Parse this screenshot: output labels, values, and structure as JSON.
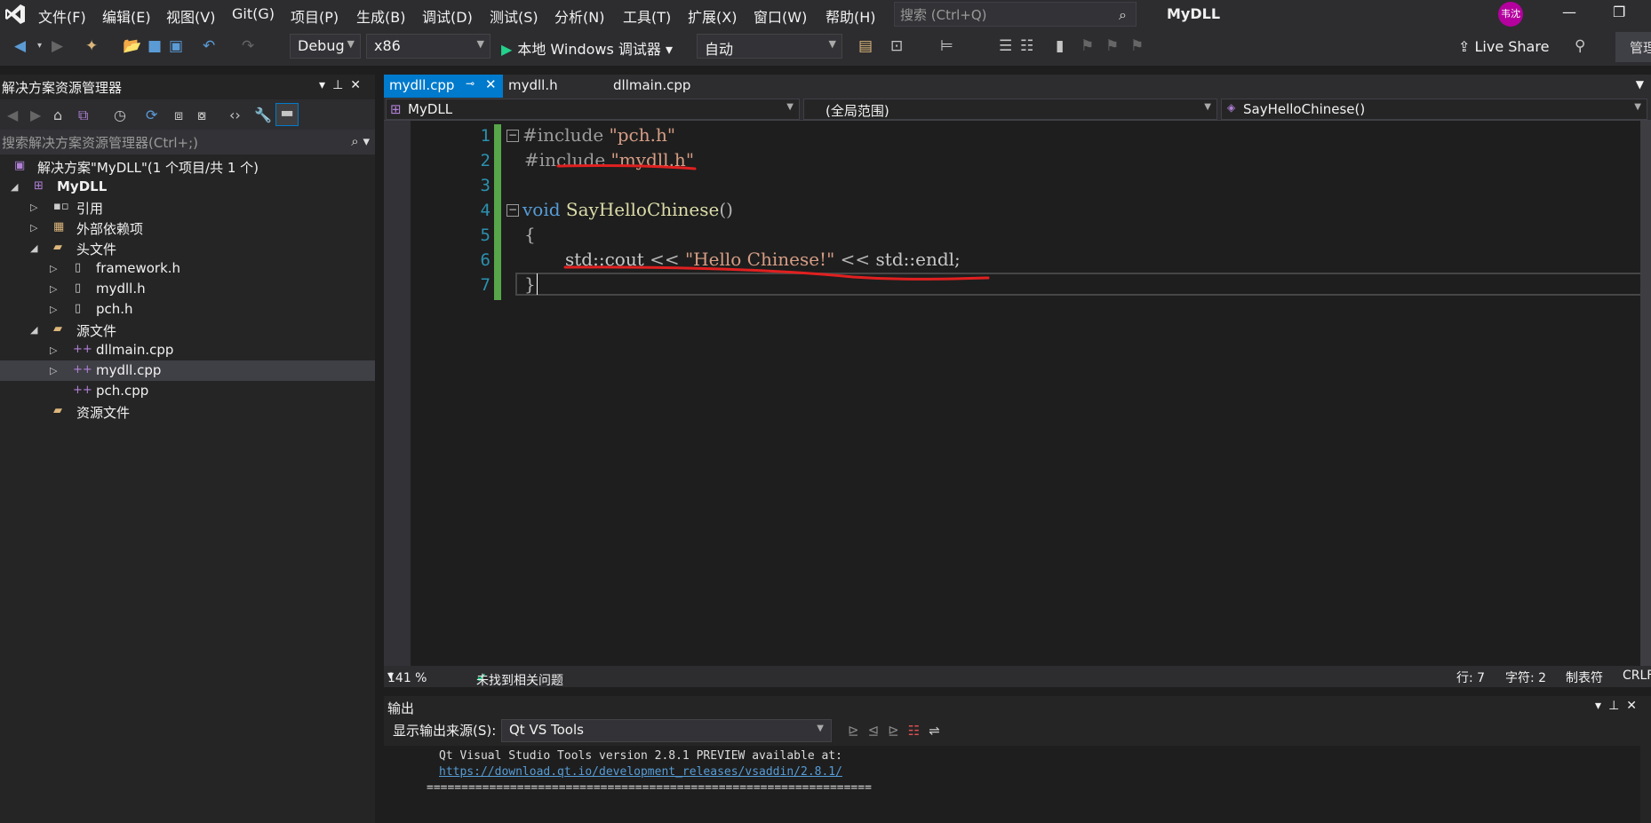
{
  "menubar": {
    "items": [
      "文件(F)",
      "编辑(E)",
      "视图(V)",
      "Git(G)",
      "项目(P)",
      "生成(B)",
      "调试(D)",
      "测试(S)",
      "分析(N)",
      "工具(T)",
      "扩展(X)",
      "窗口(W)",
      "帮助(H)"
    ],
    "search_placeholder": "搜索 (Ctrl+Q)",
    "title": "MyDLL",
    "avatar_text": "韦沈"
  },
  "toolbar": {
    "config": "Debug",
    "platform": "x86",
    "run_label": "本地 Windows 调试器",
    "auto": "自动",
    "live_share": "Live Share",
    "manage": "管理"
  },
  "solution_explorer": {
    "title": "解决方案资源管理器",
    "search_placeholder": "搜索解决方案资源管理器(Ctrl+;)",
    "tree": [
      {
        "label": "解决方案\"MyDLL\"(1 个项目/共 1 个)",
        "icon": "solution-icon"
      },
      {
        "label": "MyDLL",
        "icon": "project-icon"
      },
      {
        "label": "引用",
        "icon": "references-icon"
      },
      {
        "label": "外部依赖项",
        "icon": "external-deps-icon"
      },
      {
        "label": "头文件",
        "icon": "folder-icon"
      },
      {
        "label": "framework.h",
        "icon": "header-file-icon"
      },
      {
        "label": "mydll.h",
        "icon": "header-file-icon"
      },
      {
        "label": "pch.h",
        "icon": "header-file-icon"
      },
      {
        "label": "源文件",
        "icon": "folder-icon"
      },
      {
        "label": "dllmain.cpp",
        "icon": "cpp-file-icon"
      },
      {
        "label": "mydll.cpp",
        "icon": "cpp-file-icon"
      },
      {
        "label": "pch.cpp",
        "icon": "cpp-file-icon"
      },
      {
        "label": "资源文件",
        "icon": "folder-icon"
      }
    ]
  },
  "editor": {
    "tabs": [
      "mydll.cpp",
      "mydll.h",
      "dllmain.cpp"
    ],
    "nav_project": "MyDLL",
    "nav_scope": "(全局范围)",
    "nav_member": "SayHelloChinese()",
    "line_numbers": [
      "1",
      "2",
      "3",
      "4",
      "5",
      "6",
      "7"
    ],
    "code": {
      "l1_directive": "#include",
      "l1_file": "\"pch.h\"",
      "l2_directive": "#include",
      "l2_file": "\"mydll.h\"",
      "l4_type": "void",
      "l4_name": "SayHelloChinese",
      "l4_parens": "()",
      "l5": "{",
      "l6_ns1": "std::cout",
      "l6_op1": "<<",
      "l6_str": "\"Hello Chinese!\"",
      "l6_op2": "<<",
      "l6_ns2": "std::endl;",
      "l7": "}"
    },
    "zoom": "141 %",
    "issues": "未找到相关问题",
    "row": "行: 7",
    "col": "字符: 2",
    "tabs_mode": "制表符",
    "eol": "CRLF"
  },
  "output": {
    "title": "输出",
    "source_label": "显示输出来源(S):",
    "source_value": "Qt VS Tools",
    "line1": "Qt Visual Studio Tools version 2.8.1 PREVIEW available at:",
    "link": "https://download.qt.io/development_releases/vsaddin/2.8.1/",
    "separator": "================================================================"
  },
  "colors": {
    "accent": "#007acc",
    "annotation": "#e02020",
    "changed_bar": "#57a64a"
  }
}
